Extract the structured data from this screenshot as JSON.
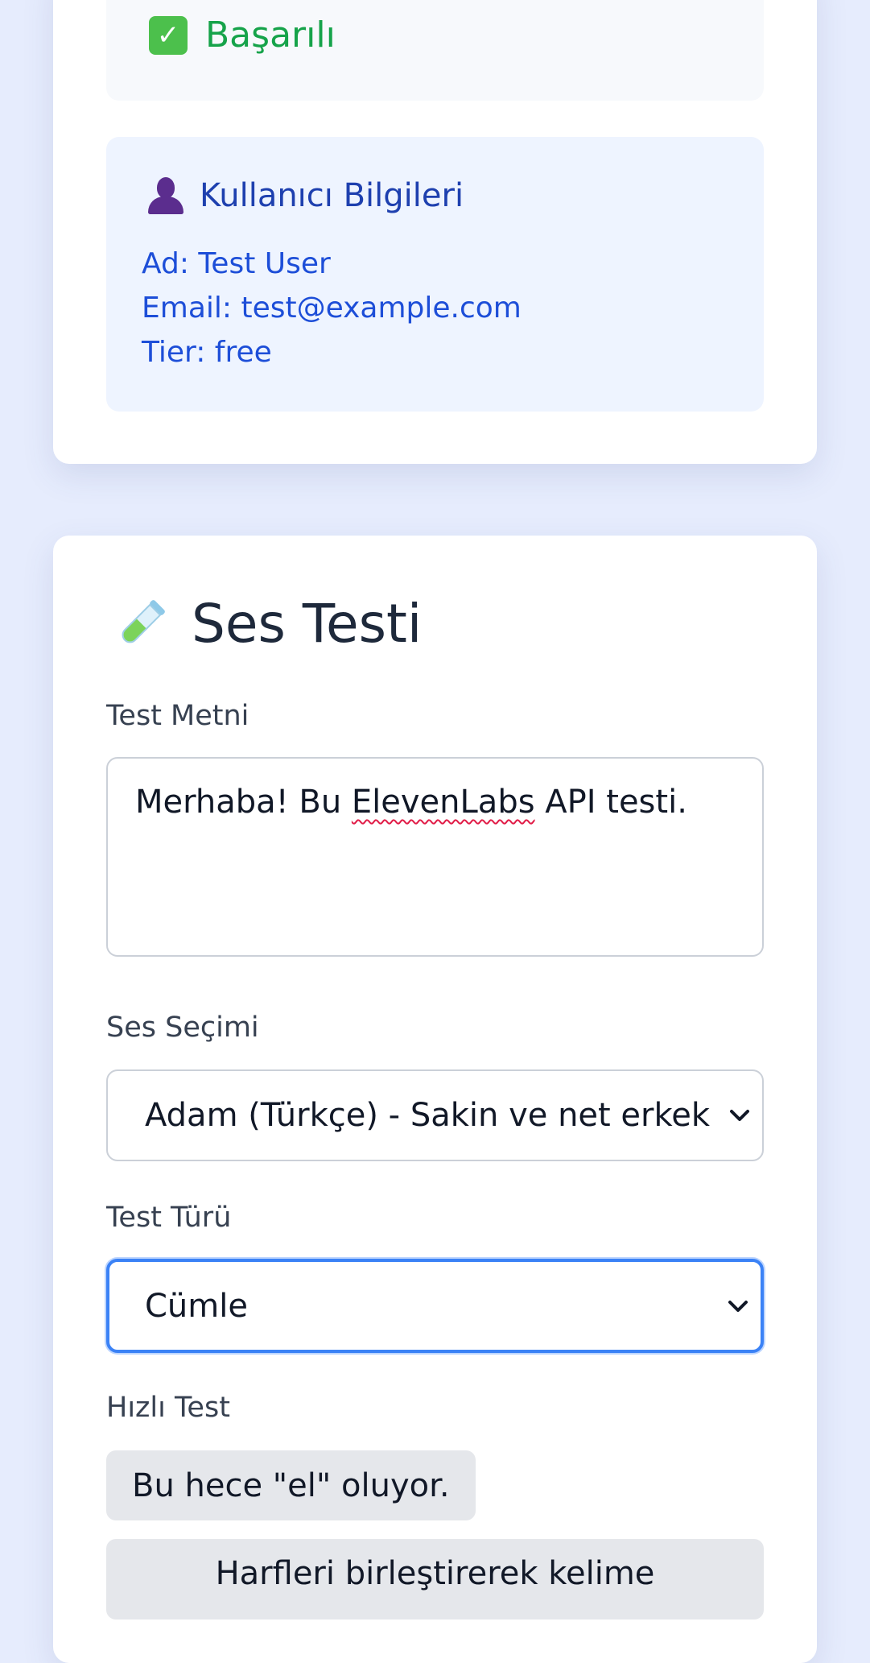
{
  "status": {
    "text": "Başarılı",
    "icon": "check-mark-icon",
    "color": "#16a34a"
  },
  "user_info": {
    "title": "Kullanıcı Bilgileri",
    "icon": "user-silhouette-icon",
    "name_line": "Ad: Test User",
    "email_line": "Email: test@example.com",
    "tier_line": "Tier: free"
  },
  "voice_test": {
    "title": "Ses Testi",
    "icon": "test-tube-icon",
    "test_text": {
      "label": "Test Metni",
      "value_before": "Merhaba! Bu ",
      "value_misspelled": "ElevenLabs",
      "value_after": " API testi."
    },
    "voice_select": {
      "label": "Ses Seçimi",
      "selected": "Adam (Türkçe) - Sakin ve net erkek"
    },
    "test_type": {
      "label": "Test Türü",
      "selected": "Cümle"
    },
    "quick_test": {
      "label": "Hızlı Test",
      "buttons": [
        "Bu hece \"el\" oluyor.",
        "Harfleri birleştirerek kelime"
      ]
    }
  },
  "colors": {
    "background": "#e6ecfd",
    "accent_focus": "#3b82f6",
    "user_info_text": "#1d4ed8"
  }
}
